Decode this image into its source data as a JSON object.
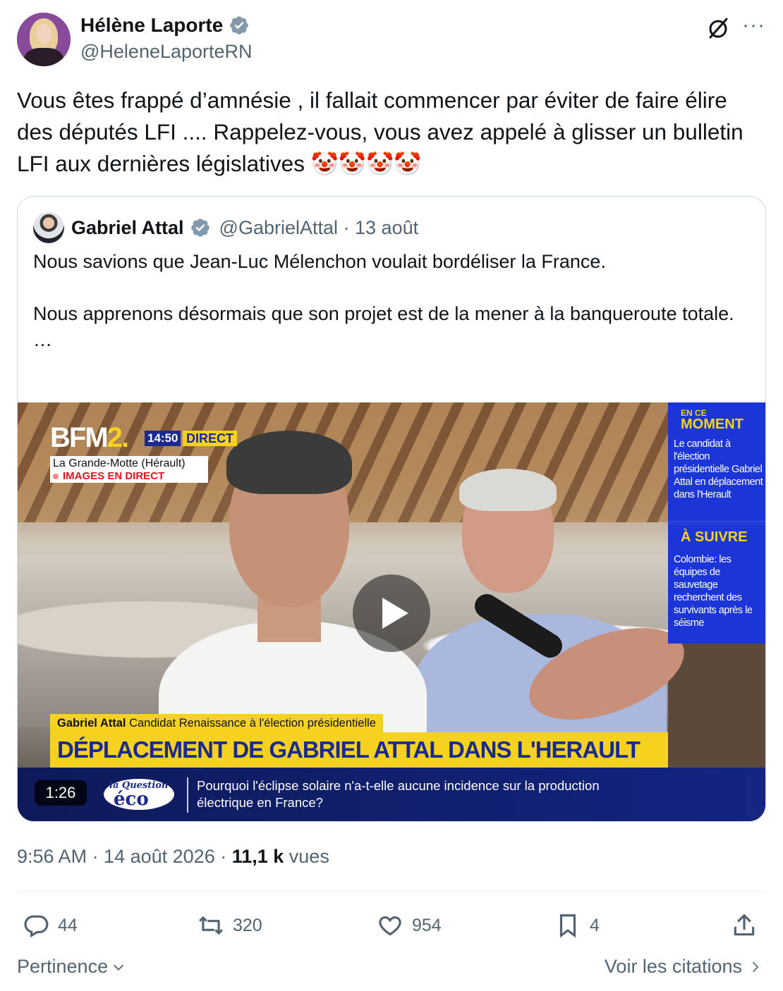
{
  "author": {
    "display_name": "Hélène Laporte",
    "handle": "@HeleneLaporteRN"
  },
  "tweet": {
    "text": "Vous êtes frappé d’amnésie , il fallait commencer par éviter de faire élire des députés LFI .... Rappelez-vous, vous avez appelé à glisser un bulletin LFI aux dernières législatives 🤡🤡🤡🤡"
  },
  "quote": {
    "display_name": "Gabriel Attal",
    "meta": "@GabrielAttal · 13 août",
    "text": "Nous savions que Jean-Luc Mélenchon voulait bordéliser la France.\n\nNous apprenons désormais que son projet est de la mener à la banqueroute totale.\n…",
    "video": {
      "duration": "1:26",
      "channel_logo_main": "BFM",
      "channel_logo_num": "2.",
      "time": "14:50",
      "direct_label": "DIRECT",
      "location": "La Grande-Motte (Hérault)",
      "live_label": "IMAGES EN DIRECT",
      "side_en_ce": "EN CE",
      "side_moment": "MOMENT",
      "side_moment_text": "Le candidat à l'élection présidentielle Gabriel Attal en déplacement dans l'Herault",
      "side_a_suivre": "À SUIVRE",
      "side_a_suivre_text": "Colombie: les équipes de sauvetage recherchent des survivants après le séisme",
      "subtitle_name": "Gabriel Attal",
      "subtitle_role": "Candidat Renaissance à l'élection présidentielle",
      "headline": "DÉPLACEMENT DE GABRIEL ATTAL DANS L'HERAULT",
      "eco_logo_top": "la Question",
      "eco_logo_word": "éco",
      "ticker": "Pourquoi l'éclipse solaire n'a-t-elle aucune incidence sur la production électrique en France?"
    }
  },
  "meta": {
    "time_date": "9:56 AM · 14 août 2026 · ",
    "views_count": "11,1 k",
    "views_label": " vues"
  },
  "actions": {
    "replies": "44",
    "retweets": "320",
    "likes": "954",
    "bookmarks": "4"
  },
  "footer": {
    "sort_label": "Pertinence",
    "quotes_link": "Voir les citations"
  },
  "colors": {
    "text_primary": "#0f1419",
    "text_secondary": "#536471",
    "verified_blue": "#829aab",
    "bfm_yellow": "#f5d21f",
    "bfm_blue": "#1b35d6"
  }
}
